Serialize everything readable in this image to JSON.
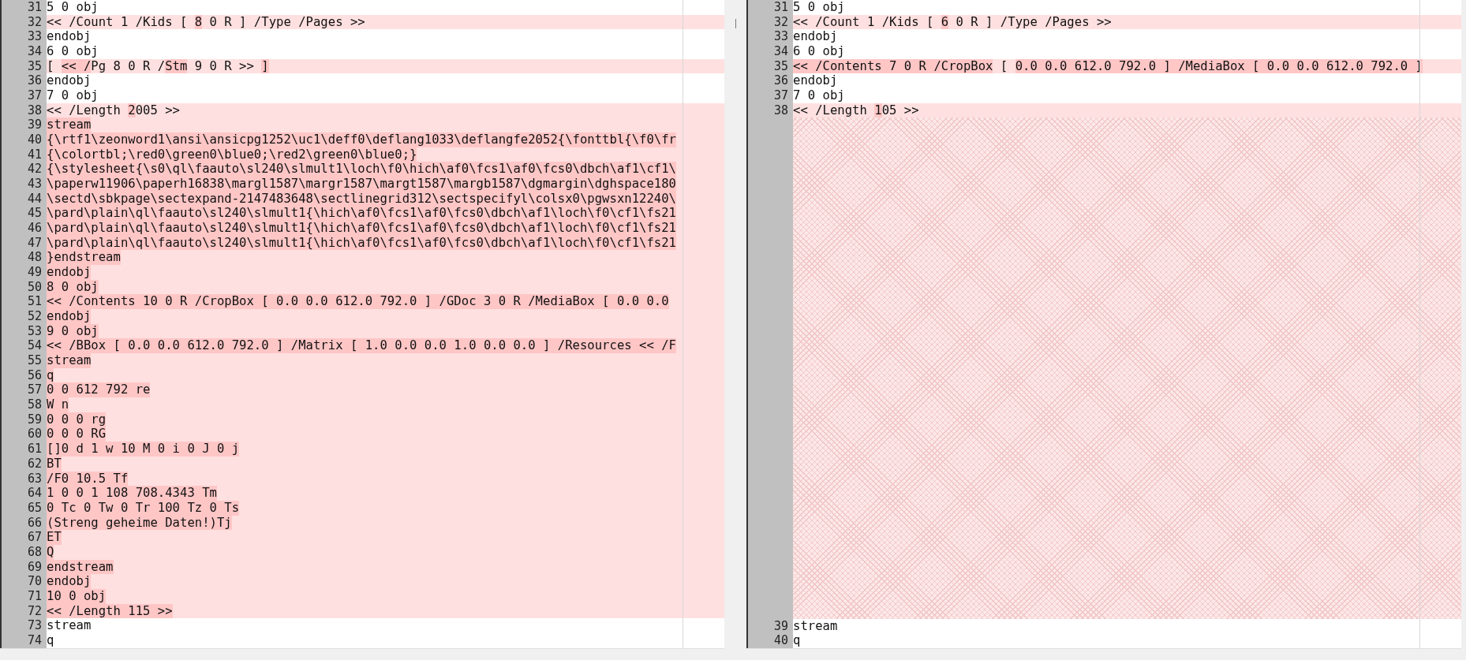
{
  "panes": [
    {
      "lines": [
        {
          "kind": "line",
          "number": "31",
          "changed": false,
          "parts": [
            {
              "text": "5 0 obj",
              "changed": false
            }
          ]
        },
        {
          "kind": "line",
          "number": "32",
          "changed": true,
          "parts": [
            {
              "text": "<< /Count 1 /Kids [ ",
              "changed": false
            },
            {
              "text": "8",
              "changed": true
            },
            {
              "text": " 0 R ] /Type /Pages >>",
              "changed": false
            }
          ]
        },
        {
          "kind": "line",
          "number": "33",
          "changed": false,
          "parts": [
            {
              "text": "endobj",
              "changed": false
            }
          ]
        },
        {
          "kind": "line",
          "number": "34",
          "changed": false,
          "parts": [
            {
              "text": "6 0 obj",
              "changed": false
            }
          ]
        },
        {
          "kind": "line",
          "number": "35",
          "changed": true,
          "parts": [
            {
              "text": "[ ",
              "changed": false
            },
            {
              "text": "<< /",
              "changed": true
            },
            {
              "text": "Pg 8 0 R /",
              "changed": false
            },
            {
              "text": "Stm",
              "changed": true
            },
            {
              "text": " 9 0 R >> ",
              "changed": false
            },
            {
              "text": "]",
              "changed": true
            }
          ]
        },
        {
          "kind": "line",
          "number": "36",
          "changed": false,
          "parts": [
            {
              "text": "endobj",
              "changed": false
            }
          ]
        },
        {
          "kind": "line",
          "number": "37",
          "changed": false,
          "parts": [
            {
              "text": "7 0 obj",
              "changed": false
            }
          ]
        },
        {
          "kind": "line",
          "number": "38",
          "changed": true,
          "parts": [
            {
              "text": "<< /Length ",
              "changed": false
            },
            {
              "text": "2",
              "changed": true
            },
            {
              "text": "005 >>",
              "changed": false
            }
          ]
        },
        {
          "kind": "line",
          "number": "39",
          "changed": true,
          "parts": [
            {
              "text": "stream",
              "changed": true
            }
          ]
        },
        {
          "kind": "line",
          "number": "40",
          "changed": true,
          "parts": [
            {
              "text": "{\\rtf1\\zeonword1\\ansi\\ansicpg1252\\uc1\\deff0\\deflang1033\\deflangfe2052{\\fonttbl{\\f0\\fr",
              "changed": true
            }
          ]
        },
        {
          "kind": "line",
          "number": "41",
          "changed": true,
          "parts": [
            {
              "text": "{\\colortbl;\\red0\\green0\\blue0;\\red2\\green0\\blue0;}",
              "changed": true
            }
          ]
        },
        {
          "kind": "line",
          "number": "42",
          "changed": true,
          "parts": [
            {
              "text": "{\\stylesheet{\\s0\\ql\\faauto\\sl240\\slmult1\\loch\\f0\\hich\\af0\\fcs1\\af0\\fcs0\\dbch\\af1\\cf1\\",
              "changed": true
            }
          ]
        },
        {
          "kind": "line",
          "number": "43",
          "changed": true,
          "parts": [
            {
              "text": "\\paperw11906\\paperh16838\\margl1587\\margr1587\\margt1587\\margb1587\\dgmargin\\dghspace180",
              "changed": true
            }
          ]
        },
        {
          "kind": "line",
          "number": "44",
          "changed": true,
          "parts": [
            {
              "text": "\\sectd\\sbkpage\\sectexpand-2147483648\\sectlinegrid312\\sectspecifyl\\colsx0\\pgwsxn12240\\",
              "changed": true
            }
          ]
        },
        {
          "kind": "line",
          "number": "45",
          "changed": true,
          "parts": [
            {
              "text": "\\pard\\plain\\ql\\faauto\\sl240\\slmult1{\\hich\\af0\\fcs1\\af0\\fcs0\\dbch\\af1\\loch\\f0\\cf1\\fs21",
              "changed": true
            }
          ]
        },
        {
          "kind": "line",
          "number": "46",
          "changed": true,
          "parts": [
            {
              "text": "\\pard\\plain\\ql\\faauto\\sl240\\slmult1{\\hich\\af0\\fcs1\\af0\\fcs0\\dbch\\af1\\loch\\f0\\cf1\\fs21",
              "changed": true
            }
          ]
        },
        {
          "kind": "line",
          "number": "47",
          "changed": true,
          "parts": [
            {
              "text": "\\pard\\plain\\ql\\faauto\\sl240\\slmult1{\\hich\\af0\\fcs1\\af0\\fcs0\\dbch\\af1\\loch\\f0\\cf1\\fs21",
              "changed": true
            }
          ]
        },
        {
          "kind": "line",
          "number": "48",
          "changed": true,
          "parts": [
            {
              "text": "}endstream",
              "changed": true
            }
          ]
        },
        {
          "kind": "line",
          "number": "49",
          "changed": true,
          "parts": [
            {
              "text": "endobj",
              "changed": true
            }
          ]
        },
        {
          "kind": "line",
          "number": "50",
          "changed": true,
          "parts": [
            {
              "text": "8 0 obj",
              "changed": true
            }
          ]
        },
        {
          "kind": "line",
          "number": "51",
          "changed": true,
          "parts": [
            {
              "text": "<< /Contents 10 0 R /CropBox [ 0.0 0.0 612.0 792.0 ] /GDoc 3 0 R /MediaBox [ 0.0 0.0",
              "changed": true
            }
          ]
        },
        {
          "kind": "line",
          "number": "52",
          "changed": true,
          "parts": [
            {
              "text": "endobj",
              "changed": true
            }
          ]
        },
        {
          "kind": "line",
          "number": "53",
          "changed": true,
          "parts": [
            {
              "text": "9 0 obj",
              "changed": true
            }
          ]
        },
        {
          "kind": "line",
          "number": "54",
          "changed": true,
          "parts": [
            {
              "text": "<< /BBox [ 0.0 0.0 612.0 792.0 ] /Matrix [ 1.0 0.0 0.0 1.0 0.0 0.0 ] /Resources << /F",
              "changed": true
            }
          ]
        },
        {
          "kind": "line",
          "number": "55",
          "changed": true,
          "parts": [
            {
              "text": "stream",
              "changed": true
            }
          ]
        },
        {
          "kind": "line",
          "number": "56",
          "changed": true,
          "parts": [
            {
              "text": "q",
              "changed": true
            }
          ]
        },
        {
          "kind": "line",
          "number": "57",
          "changed": true,
          "parts": [
            {
              "text": "0 0 612 792 re",
              "changed": true
            }
          ]
        },
        {
          "kind": "line",
          "number": "58",
          "changed": true,
          "parts": [
            {
              "text": "W n",
              "changed": true
            }
          ]
        },
        {
          "kind": "line",
          "number": "59",
          "changed": true,
          "parts": [
            {
              "text": "0 0 0 rg",
              "changed": true
            }
          ]
        },
        {
          "kind": "line",
          "number": "60",
          "changed": true,
          "parts": [
            {
              "text": "0 0 0 RG",
              "changed": true
            }
          ]
        },
        {
          "kind": "line",
          "number": "61",
          "changed": true,
          "parts": [
            {
              "text": "[]0 d 1 w 10 M 0 i 0 J 0 j",
              "changed": true
            }
          ]
        },
        {
          "kind": "line",
          "number": "62",
          "changed": true,
          "parts": [
            {
              "text": "BT",
              "changed": true
            }
          ]
        },
        {
          "kind": "line",
          "number": "63",
          "changed": true,
          "parts": [
            {
              "text": "/F0 10.5 Tf",
              "changed": true
            }
          ]
        },
        {
          "kind": "line",
          "number": "64",
          "changed": true,
          "parts": [
            {
              "text": "1 0 0 1 108 708.4343 Tm",
              "changed": true
            }
          ]
        },
        {
          "kind": "line",
          "number": "65",
          "changed": true,
          "parts": [
            {
              "text": "0 Tc 0 Tw 0 Tr 100 Tz 0 Ts",
              "changed": true
            }
          ]
        },
        {
          "kind": "line",
          "number": "66",
          "changed": true,
          "parts": [
            {
              "text": "(Streng geheime Daten!)Tj",
              "changed": true
            }
          ]
        },
        {
          "kind": "line",
          "number": "67",
          "changed": true,
          "parts": [
            {
              "text": "ET",
              "changed": true
            }
          ]
        },
        {
          "kind": "line",
          "number": "68",
          "changed": true,
          "parts": [
            {
              "text": "Q",
              "changed": true
            }
          ]
        },
        {
          "kind": "line",
          "number": "69",
          "changed": true,
          "parts": [
            {
              "text": "endstream",
              "changed": true
            }
          ]
        },
        {
          "kind": "line",
          "number": "70",
          "changed": true,
          "parts": [
            {
              "text": "endobj",
              "changed": true
            }
          ]
        },
        {
          "kind": "line",
          "number": "71",
          "changed": true,
          "parts": [
            {
              "text": "10 0 obj",
              "changed": true
            }
          ]
        },
        {
          "kind": "line",
          "number": "72",
          "changed": true,
          "parts": [
            {
              "text": "<< /Length 115 >>",
              "changed": true
            }
          ]
        },
        {
          "kind": "line",
          "number": "73",
          "changed": false,
          "parts": [
            {
              "text": "stream",
              "changed": false
            }
          ]
        },
        {
          "kind": "line",
          "number": "74",
          "changed": false,
          "parts": [
            {
              "text": "q",
              "changed": false
            }
          ]
        }
      ]
    },
    {
      "lines": [
        {
          "kind": "line",
          "number": "31",
          "changed": false,
          "parts": [
            {
              "text": "5 0 obj",
              "changed": false
            }
          ]
        },
        {
          "kind": "line",
          "number": "32",
          "changed": true,
          "parts": [
            {
              "text": "<< /Count 1 /Kids [ ",
              "changed": false
            },
            {
              "text": "6",
              "changed": true
            },
            {
              "text": " 0 R ] /Type /Pages >>",
              "changed": false
            }
          ]
        },
        {
          "kind": "line",
          "number": "33",
          "changed": false,
          "parts": [
            {
              "text": "endobj",
              "changed": false
            }
          ]
        },
        {
          "kind": "line",
          "number": "34",
          "changed": false,
          "parts": [
            {
              "text": "6 0 obj",
              "changed": false
            }
          ]
        },
        {
          "kind": "line",
          "number": "35",
          "changed": true,
          "parts": [
            {
              "text": "<< /Contents 7 0 R /CropBox",
              "changed": true
            },
            {
              "text": " [ ",
              "changed": false
            },
            {
              "text": "0.0 0.0 612.0 792.0 ] /MediaBox [ 0.0 0.0 612.0 792.0 ]",
              "changed": true
            }
          ]
        },
        {
          "kind": "line",
          "number": "36",
          "changed": false,
          "parts": [
            {
              "text": "endobj",
              "changed": false
            }
          ]
        },
        {
          "kind": "line",
          "number": "37",
          "changed": false,
          "parts": [
            {
              "text": "7 0 obj",
              "changed": false
            }
          ]
        },
        {
          "kind": "line",
          "number": "38",
          "changed": true,
          "parts": [
            {
              "text": "<< /Length ",
              "changed": false
            },
            {
              "text": "1",
              "changed": true
            },
            {
              "text": "05 >>",
              "changed": false
            }
          ]
        },
        {
          "kind": "gap"
        },
        {
          "kind": "line",
          "number": "39",
          "changed": false,
          "parts": [
            {
              "text": "stream",
              "changed": false
            }
          ]
        },
        {
          "kind": "line",
          "number": "40",
          "changed": false,
          "parts": [
            {
              "text": "q",
              "changed": false
            }
          ]
        }
      ]
    }
  ]
}
